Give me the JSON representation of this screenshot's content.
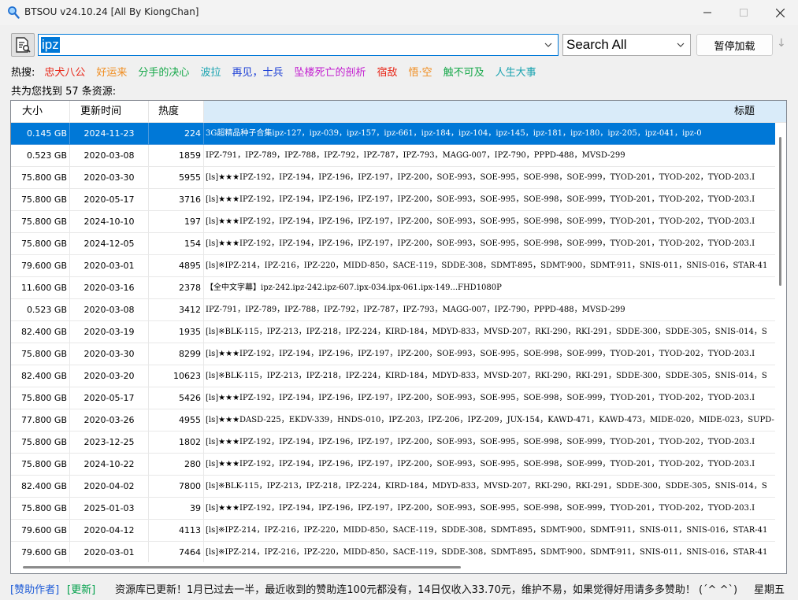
{
  "window": {
    "title": "BTSOU v24.10.24 [All By KiongChan]",
    "minimize": "—",
    "maximize": "☐",
    "close": "✕"
  },
  "toolbar": {
    "search_value": "ipz",
    "scope_value": "Search All",
    "pause_label": "暂停加载",
    "download_icon": "↓"
  },
  "hot": {
    "label": "热搜:",
    "items": [
      {
        "text": "忠犬八公",
        "color": "#e8281a"
      },
      {
        "text": "好运来",
        "color": "#f08c1e"
      },
      {
        "text": "分手的决心",
        "color": "#17a84a"
      },
      {
        "text": "波拉",
        "color": "#1aa3b0"
      },
      {
        "text": "再见，士兵",
        "color": "#1c3fd6"
      },
      {
        "text": "坠楼死亡的剖析",
        "color": "#c21ed0"
      },
      {
        "text": "宿敌",
        "color": "#e8281a"
      },
      {
        "text": "悟·空",
        "color": "#f08c1e"
      },
      {
        "text": "触不可及",
        "color": "#17a84a"
      },
      {
        "text": "人生大事",
        "color": "#1aa3b0"
      }
    ]
  },
  "result_count": "共为您找到 57 条资源:",
  "table": {
    "headers": {
      "size": "大小",
      "date": "更新时间",
      "heat": "热度",
      "title": "标题"
    },
    "rows": [
      {
        "size": "0.145 GB",
        "date": "2024-11-23",
        "heat": "224",
        "title": "3G超精品种子合集ipz-127，ipz-039，ipz-157，ipz-661，ipz-184，ipz-104，ipz-145，ipz-181，ipz-180，ipz-205，ipz-041，ipz-0"
      },
      {
        "size": "0.523 GB",
        "date": "2020-03-08",
        "heat": "1859",
        "title": "IPZ-791，IPZ-789，IPZ-788，IPZ-792，IPZ-787，IPZ-793，MAGG-007，IPZ-790，PPPD-488，MVSD-299"
      },
      {
        "size": "75.800 GB",
        "date": "2020-03-30",
        "heat": "5955",
        "title": "[ls]★★★IPZ-192，IPZ-194，IPZ-196，IPZ-197，IPZ-200，SOE-993，SOE-995，SOE-998，SOE-999，TYOD-201，TYOD-202，TYOD-203.I"
      },
      {
        "size": "75.800 GB",
        "date": "2020-05-17",
        "heat": "3716",
        "title": "[ls]★★★IPZ-192，IPZ-194，IPZ-196，IPZ-197，IPZ-200，SOE-993，SOE-995，SOE-998，SOE-999，TYOD-201，TYOD-202，TYOD-203.I"
      },
      {
        "size": "75.800 GB",
        "date": "2024-10-10",
        "heat": "197",
        "title": "[ls]★★★IPZ-192，IPZ-194，IPZ-196，IPZ-197，IPZ-200，SOE-993，SOE-995，SOE-998，SOE-999，TYOD-201，TYOD-202，TYOD-203.I"
      },
      {
        "size": "75.800 GB",
        "date": "2024-12-05",
        "heat": "154",
        "title": "[ls]★★★IPZ-192，IPZ-194，IPZ-196，IPZ-197，IPZ-200，SOE-993，SOE-995，SOE-998，SOE-999，TYOD-201，TYOD-202，TYOD-203.I"
      },
      {
        "size": "79.600 GB",
        "date": "2020-03-01",
        "heat": "4895",
        "title": "[ls]※IPZ-214，IPZ-216，IPZ-220，MIDD-850，SACE-119，SDDE-308，SDMT-895，SDMT-900，SDMT-911，SNIS-011，SNIS-016，STAR-41"
      },
      {
        "size": "11.600 GB",
        "date": "2020-03-16",
        "heat": "2378",
        "title": "【全中文字幕】ipz-242.ipz-242.ipz-607.ipx-034.ipx-061.ipx-149...FHD1080P"
      },
      {
        "size": "0.523 GB",
        "date": "2020-03-08",
        "heat": "3412",
        "title": "IPZ-791，IPZ-789，IPZ-788，IPZ-792，IPZ-787，IPZ-793，MAGG-007，IPZ-790，PPPD-488，MVSD-299"
      },
      {
        "size": "82.400 GB",
        "date": "2020-03-19",
        "heat": "1935",
        "title": "[ls]※BLK-115，IPZ-213，IPZ-218，IPZ-224，KIRD-184，MDYD-833，MVSD-207，RKI-290，RKI-291，SDDE-300，SDDE-305，SNIS-014，S"
      },
      {
        "size": "75.800 GB",
        "date": "2020-03-30",
        "heat": "8299",
        "title": "[ls]★★★IPZ-192，IPZ-194，IPZ-196，IPZ-197，IPZ-200，SOE-993，SOE-995，SOE-998，SOE-999，TYOD-201，TYOD-202，TYOD-203.I"
      },
      {
        "size": "82.400 GB",
        "date": "2020-03-20",
        "heat": "10623",
        "title": "[ls]※BLK-115，IPZ-213，IPZ-218，IPZ-224，KIRD-184，MDYD-833，MVSD-207，RKI-290，RKI-291，SDDE-300，SDDE-305，SNIS-014，S"
      },
      {
        "size": "75.800 GB",
        "date": "2020-05-17",
        "heat": "5426",
        "title": "[ls]★★★IPZ-192，IPZ-194，IPZ-196，IPZ-197，IPZ-200，SOE-993，SOE-995，SOE-998，SOE-999，TYOD-201，TYOD-202，TYOD-203.I"
      },
      {
        "size": "77.800 GB",
        "date": "2020-03-26",
        "heat": "4955",
        "title": "[ls]★★★DASD-225，EKDV-339，HNDS-010，IPZ-203，IPZ-206，IPZ-209，JUX-154，KAWD-471，KAWD-473，MIDE-020，MIDE-023，SUPD-"
      },
      {
        "size": "75.800 GB",
        "date": "2023-12-25",
        "heat": "1802",
        "title": "[ls]★★★IPZ-192，IPZ-194，IPZ-196，IPZ-197，IPZ-200，SOE-993，SOE-995，SOE-998，SOE-999，TYOD-201，TYOD-202，TYOD-203.I"
      },
      {
        "size": "75.800 GB",
        "date": "2024-10-22",
        "heat": "280",
        "title": "[ls]★★★IPZ-192，IPZ-194，IPZ-196，IPZ-197，IPZ-200，SOE-993，SOE-995，SOE-998，SOE-999，TYOD-201，TYOD-202，TYOD-203.I"
      },
      {
        "size": "82.400 GB",
        "date": "2020-04-02",
        "heat": "7800",
        "title": "[ls]※BLK-115，IPZ-213，IPZ-218，IPZ-224，KIRD-184，MDYD-833，MVSD-207，RKI-290，RKI-291，SDDE-300，SDDE-305，SNIS-014，S"
      },
      {
        "size": "75.800 GB",
        "date": "2025-01-03",
        "heat": "39",
        "title": "[ls]★★★IPZ-192，IPZ-194，IPZ-196，IPZ-197，IPZ-200，SOE-993，SOE-995，SOE-998，SOE-999，TYOD-201，TYOD-202，TYOD-203.I"
      },
      {
        "size": "79.600 GB",
        "date": "2020-04-12",
        "heat": "4113",
        "title": "[ls]※IPZ-214，IPZ-216，IPZ-220，MIDD-850，SACE-119，SDDE-308，SDMT-895，SDMT-900，SDMT-911，SNIS-011，SNIS-016，STAR-41"
      },
      {
        "size": "79.600 GB",
        "date": "2020-03-01",
        "heat": "7464",
        "title": "[ls]※IPZ-214，IPZ-216，IPZ-220，MIDD-850，SACE-119，SDDE-308，SDMT-895，SDMT-900，SDMT-911，SNIS-011，SNIS-016，STAR-41"
      }
    ]
  },
  "status": {
    "sponsor": "[赞助作者]",
    "update": "[更新]",
    "message": "资源库已更新！1月已过去一半，最近收到的赞助连100元都没有，14日仅收入33.70元，维护不易，如果觉得好用请多多赞助！ (´^ ^`)",
    "weekday": "星期五"
  }
}
